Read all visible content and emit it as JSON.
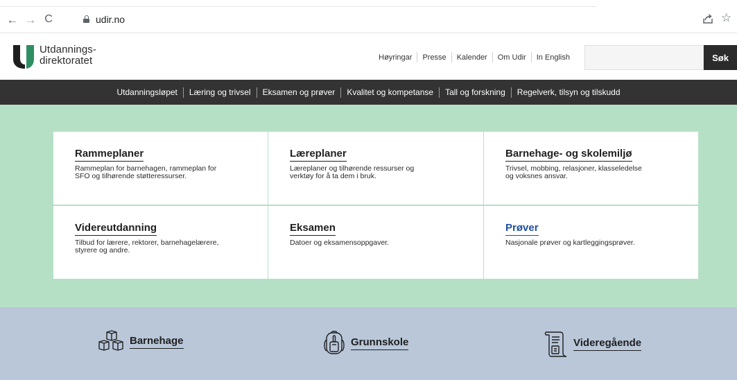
{
  "browser": {
    "url": "udir.no",
    "back_glyph": "←",
    "forward_glyph": "→",
    "reload_glyph": "C",
    "star_glyph": "☆",
    "icons": [
      "back-arrow-icon",
      "forward-arrow-icon",
      "reload-icon",
      "lock-icon",
      "share-icon",
      "star-icon"
    ]
  },
  "header": {
    "logo_line1": "Utdannings-",
    "logo_line2": "direktoratet",
    "top_links": [
      "Høyringar",
      "Presse",
      "Kalender",
      "Om Udir",
      "In English"
    ],
    "search_placeholder": "",
    "search_button": "Søk"
  },
  "main_nav": {
    "items": [
      "Utdanningsløpet",
      "Læring og trivsel",
      "Eksamen og prøver",
      "Kvalitet og kompetanse",
      "Tall og forskning",
      "Regelverk, tilsyn og tilskudd"
    ]
  },
  "cards": [
    {
      "title": "Rammeplaner",
      "desc_line1": "Rammeplan for barnehagen, rammeplan for",
      "desc_line2": "SFO og tilhørende støtteressurser."
    },
    {
      "title": "Læreplaner",
      "desc_line1": "Læreplaner og tilhørende ressurser og",
      "desc_line2": "verktøy for å ta dem i bruk."
    },
    {
      "title": "Barnehage- og skolemiljø",
      "desc_line1": "Trivsel, mobbing, relasjoner, klasseledelse",
      "desc_line2": "og voksnes ansvar."
    },
    {
      "title": "Videreutdanning",
      "desc_line1": "Tilbud for lærere, rektorer, barnehagelærere,",
      "desc_line2": "styrere og andre."
    },
    {
      "title": "Eksamen",
      "desc_line1": "Datoer og eksamensoppgaver.",
      "desc_line2": ""
    },
    {
      "title": "Prøver",
      "desc_line1": "Nasjonale prøver og kartleggingsprøver.",
      "desc_line2": ""
    }
  ],
  "stages": [
    {
      "label": "Barnehage",
      "icon": "blocks-icon"
    },
    {
      "label": "Grunnskole",
      "icon": "backpack-icon"
    },
    {
      "label": "Videregående",
      "icon": "scroll-icon"
    }
  ],
  "colors": {
    "green_bg": "#b6e0c6",
    "blue_bg": "#b9c7d9",
    "nav_bg": "#333333",
    "link_blue": "#1d4fa0"
  }
}
